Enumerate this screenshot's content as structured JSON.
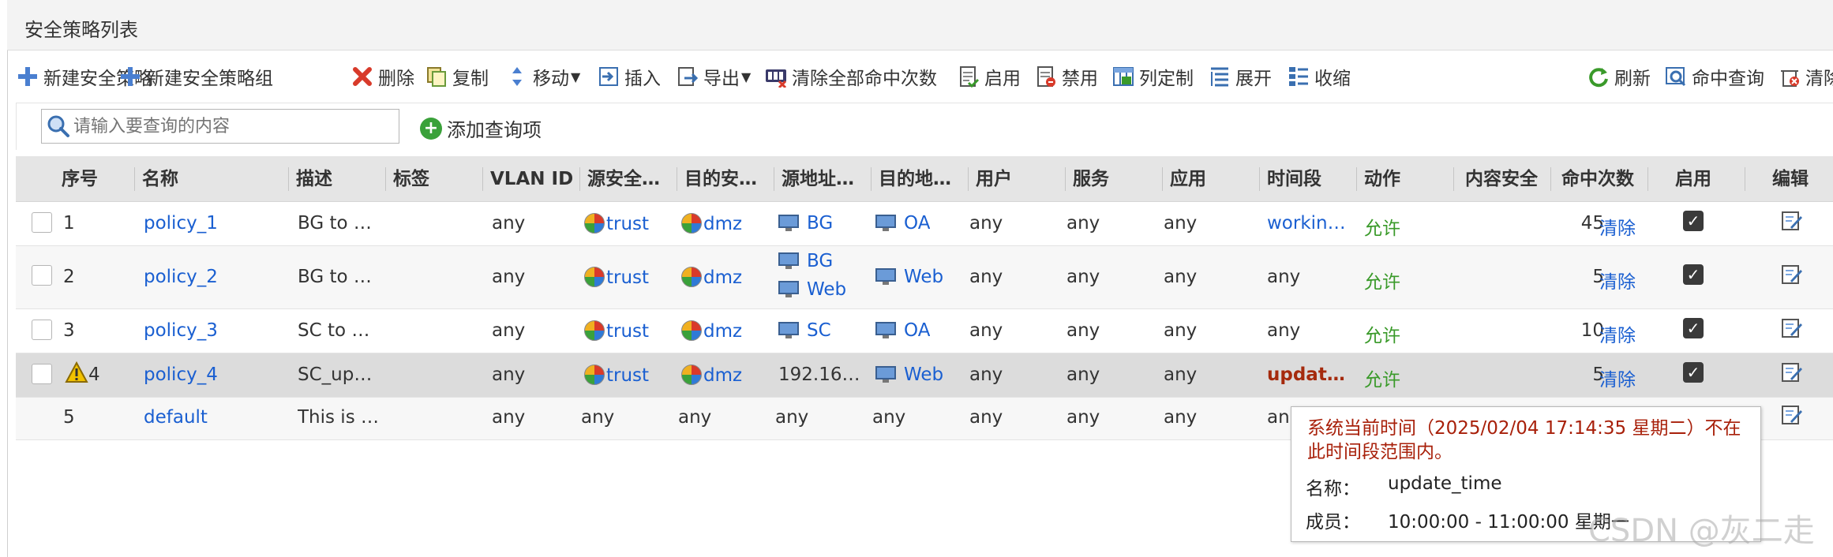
{
  "panel": {
    "title": "安全策略列表"
  },
  "toolbar": {
    "new_policy": "新建安全策略",
    "new_group": "新建安全策略组",
    "delete": "删除",
    "copy": "复制",
    "move": "移动",
    "insert": "插入",
    "export": "导出",
    "clear_all_hits": "清除全部命中次数",
    "enable": "启用",
    "disable": "禁用",
    "customize_columns": "列定制",
    "expand": "展开",
    "collapse": "收缩",
    "refresh": "刷新",
    "hit_query": "命中查询",
    "clear_truncated": "清除"
  },
  "search": {
    "placeholder": "请输入要查询的内容",
    "add_query": "添加查询项"
  },
  "columns": {
    "seq": "序号",
    "name": "名称",
    "desc": "描述",
    "tag": "标签",
    "vlan": "VLAN ID",
    "src_zone": "源安全…",
    "dst_zone": "目的安…",
    "src_addr": "源地址…",
    "dst_addr": "目的地…",
    "user": "用户",
    "service": "服务",
    "app": "应用",
    "schedule": "时间段",
    "action": "动作",
    "content_sec": "内容安全",
    "hits": "命中次数",
    "enabled": "启用",
    "edit": "编辑"
  },
  "rows": [
    {
      "seq": "1",
      "name": "policy_1",
      "desc": "BG to …",
      "vlan": "any",
      "src_zone": "trust",
      "dst_zone": "dmz",
      "src_addr": [
        "BG"
      ],
      "dst_addr": [
        "OA"
      ],
      "user": "any",
      "service": "any",
      "app": "any",
      "schedule": "workin…",
      "action": "允许",
      "hits": "45",
      "clear": "清除"
    },
    {
      "seq": "2",
      "name": "policy_2",
      "desc": "BG to …",
      "vlan": "any",
      "src_zone": "trust",
      "dst_zone": "dmz",
      "src_addr": [
        "BG",
        "Web"
      ],
      "dst_addr": [
        "Web"
      ],
      "user": "any",
      "service": "any",
      "app": "any",
      "schedule": "any",
      "action": "允许",
      "hits": "5",
      "clear": "清除"
    },
    {
      "seq": "3",
      "name": "policy_3",
      "desc": "SC to …",
      "vlan": "any",
      "src_zone": "trust",
      "dst_zone": "dmz",
      "src_addr": [
        "SC"
      ],
      "dst_addr": [
        "OA"
      ],
      "user": "any",
      "service": "any",
      "app": "any",
      "schedule": "any",
      "action": "允许",
      "hits": "10",
      "clear": "清除"
    },
    {
      "seq": "4",
      "name": "policy_4",
      "desc": "SC_up…",
      "vlan": "any",
      "src_zone": "trust",
      "dst_zone": "dmz",
      "src_addr_text": "192.16…",
      "dst_addr": [
        "Web"
      ],
      "user": "any",
      "service": "any",
      "app": "any",
      "schedule": "updat…",
      "action": "允许",
      "hits": "5",
      "clear": "清除"
    },
    {
      "seq": "5",
      "name": "default",
      "desc": "This is …",
      "vlan": "any",
      "src_zone": "any",
      "dst_zone": "any",
      "src_addr_text": "any",
      "dst_addr_text": "any",
      "user": "any",
      "service": "any",
      "app": "any",
      "schedule": "an"
    }
  ],
  "tooltip": {
    "warning": "系统当前时间（2025/02/04 17:14:35 星期二）不在此时间段范围内。",
    "name_label": "名称：",
    "name_value": "update_time",
    "member_label": "成员：",
    "member_value": "10:00:00 - 11:00:00 星期一"
  },
  "watermark": "CSDN @灰二走",
  "colors": {
    "link": "#1a5fd1",
    "allow": "#3a9a2a",
    "warning": "#a8200a",
    "header_bg": "#e5e5e5"
  },
  "icons": {
    "new_policy": "plus-icon",
    "delete": "red-x-icon",
    "copy": "copy-icon",
    "move": "move-arrows-icon",
    "insert": "insert-icon",
    "export": "export-icon",
    "clear_hits": "counter-icon",
    "enable": "enable-doc-icon",
    "disable": "disable-doc-icon",
    "columns": "columns-icon",
    "expand": "expand-icon",
    "collapse": "collapse-icon",
    "refresh": "refresh-icon",
    "hit_query": "hit-query-icon",
    "zone": "zone-pie-icon",
    "address": "computer-icon",
    "edit": "edit-icon",
    "warning": "warning-icon"
  }
}
